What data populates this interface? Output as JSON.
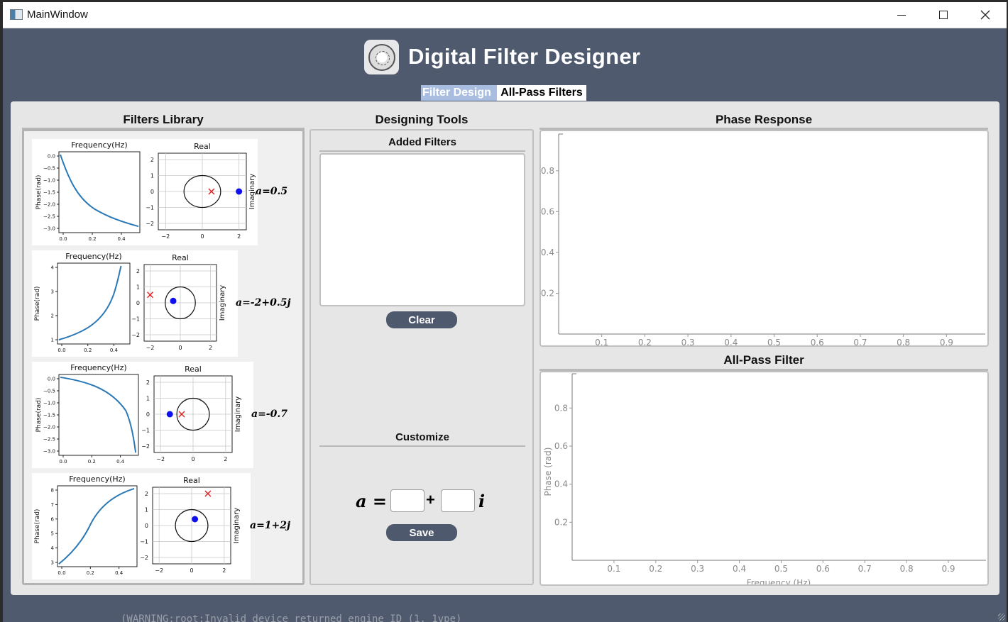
{
  "window": {
    "title": "MainWindow"
  },
  "header": {
    "title": "Digital Filter Designer"
  },
  "tabs": [
    {
      "label": "Filter Design",
      "active": true
    },
    {
      "label": "All-Pass Filters",
      "active": false
    }
  ],
  "library": {
    "title": "Filters Library",
    "plot_title": "Frequency(Hz)",
    "zplane_title": "Real",
    "ylabel_phase": "Phase(rad)",
    "ylabel_imag": "Imaginary",
    "items": [
      {
        "label": "a=0.5",
        "phase_yticks": [
          "0.0",
          "−0.5",
          "−1.0",
          "−1.5",
          "−2.0",
          "−2.5",
          "−3.0"
        ],
        "phase_xticks": [
          "0.0",
          "0.2",
          "0.4"
        ],
        "z_yticks": [
          "2",
          "1",
          "0",
          "−1",
          "−2"
        ],
        "z_xticks": [
          "−2",
          "0",
          "2"
        ]
      },
      {
        "label": "a=-2+0.5j",
        "phase_yticks": [
          "4",
          "3",
          "2",
          "1"
        ],
        "phase_xticks": [
          "0.0",
          "0.2",
          "0.4"
        ],
        "z_yticks": [
          "2",
          "1",
          "0",
          "−1",
          "−2"
        ],
        "z_xticks": [
          "−2",
          "0",
          "2"
        ]
      },
      {
        "label": "a=-0.7",
        "phase_yticks": [
          "0.0",
          "−0.5",
          "−1.0",
          "−1.5",
          "−2.0",
          "−2.5",
          "−3.0"
        ],
        "phase_xticks": [
          "0.0",
          "0.2",
          "0.4"
        ],
        "z_yticks": [
          "2",
          "1",
          "0",
          "−1",
          "−2"
        ],
        "z_xticks": [
          "−2",
          "0",
          "2"
        ]
      },
      {
        "label": "a=1+2j",
        "phase_yticks": [
          "8",
          "7",
          "6",
          "5",
          "4",
          "3"
        ],
        "phase_xticks": [
          "0.0",
          "0.2",
          "0.4"
        ],
        "z_yticks": [
          "2",
          "1",
          "0",
          "−1",
          "−2"
        ],
        "z_xticks": [
          "−2",
          "0",
          "2"
        ]
      }
    ]
  },
  "tools": {
    "title": "Designing Tools",
    "added_title": "Added Filters",
    "clear_label": "Clear",
    "customize_title": "Customize",
    "a_symbol": "a",
    "equals": "=",
    "plus": "+",
    "i_symbol": "i",
    "real_value": "",
    "imag_value": "",
    "save_label": "Save"
  },
  "phase_response": {
    "title": "Phase Response",
    "yticks": [
      "0.8",
      "0.6",
      "0.4",
      "0.2"
    ],
    "xticks": [
      "0.1",
      "0.2",
      "0.3",
      "0.4",
      "0.5",
      "0.6",
      "0.7",
      "0.8",
      "0.9"
    ]
  },
  "allpass": {
    "title": "All-Pass Filter",
    "ylabel": "Phase (rad)",
    "xlabel": "Frequency (Hz)",
    "yticks": [
      "0.8",
      "0.6",
      "0.4",
      "0.2"
    ],
    "xticks": [
      "0.1",
      "0.2",
      "0.3",
      "0.4",
      "0.5",
      "0.6",
      "0.7",
      "0.8",
      "0.9"
    ]
  },
  "console_peek": "(WARNING:root:Invalid device returned engine ID (1, 1vpe)"
}
